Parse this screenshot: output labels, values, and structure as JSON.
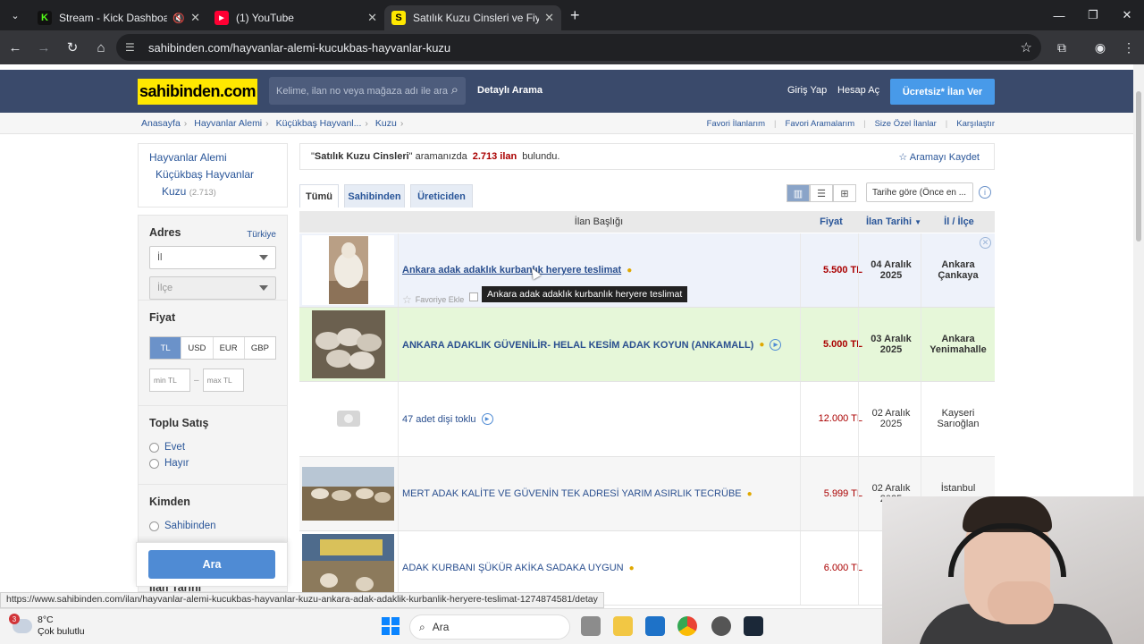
{
  "browser": {
    "tabs": [
      {
        "title": "Stream - Kick Dashboard",
        "favicon": "K",
        "color": "#53fc18",
        "active": false
      },
      {
        "title": "(1) YouTube",
        "favicon": "▶",
        "color": "#ff0033",
        "active": false
      },
      {
        "title": "Satılık Kuzu Cinsleri ve Fiyatları",
        "favicon": "S",
        "color": "#ffe800",
        "active": true
      }
    ],
    "url": "sahibinden.com/hayvanlar-alemi-kucukbas-hayvanlar-kuzu"
  },
  "header": {
    "logo": "sahibinden.com",
    "search_placeholder": "Kelime, ilan no veya mağaza adı ile ara",
    "detailed_search": "Detaylı Arama",
    "login": "Giriş Yap",
    "signup": "Hesap Aç",
    "post_ad": "Ücretsiz* İlan Ver"
  },
  "breadcrumb": [
    "Anasayfa",
    "Hayvanlar Alemi",
    "Küçükbaş Hayvanl...",
    "Kuzu"
  ],
  "toplinks": [
    "Favori İlanlarım",
    "Favori Aramalarım",
    "Size Özel İlanlar",
    "Karşılaştır"
  ],
  "sidebar": {
    "categories": {
      "l1": "Hayvanlar Alemi",
      "l2": "Küçükbaş Hayvanlar",
      "l3": "Kuzu",
      "l3_count": "(2.713)"
    },
    "adres": {
      "title": "Adres",
      "country": "Türkiye",
      "il": "İl",
      "ilce": "İlçe"
    },
    "fiyat": {
      "title": "Fiyat",
      "currencies": [
        "TL",
        "USD",
        "EUR",
        "GBP"
      ],
      "selected": "TL",
      "min_placeholder": "min TL",
      "max_placeholder": "max TL",
      "dash": "–"
    },
    "toplu": {
      "title": "Toplu Satış",
      "options": [
        "Evet",
        "Hayır"
      ]
    },
    "kimden": {
      "title": "Kimden",
      "options": [
        "Sahibinden"
      ]
    },
    "ara_button": "Ara",
    "ilan_tarihi": "İlan Tarihi"
  },
  "results": {
    "query": "Satılık Kuzu Cinsleri",
    "mid_text": "aramanızda",
    "count": "2.713 ilan",
    "suffix": "bulundu.",
    "save_search": "Aramayı Kaydet",
    "filter_tabs": [
      "Tümü",
      "Sahibinden",
      "Üreticiden"
    ],
    "sort": "Tarihe göre (Önce en ...",
    "headers": {
      "title": "İlan Başlığı",
      "price": "Fiyat",
      "date": "İlan Tarihi",
      "location": "İl / İlçe"
    },
    "favorite_label": "Favoriye Ekle",
    "listings": [
      {
        "title": "Ankara adak adaklık kurbanlık heryere teslimat",
        "price": "5.500 TL",
        "date1": "04 Aralık",
        "date2": "2025",
        "loc1": "Ankara",
        "loc2": "Çankaya",
        "bg": "#eef2fa"
      },
      {
        "title": "ANKARA ADAKLIK GÜVENİLİR- HELAL KESİM ADAK KOYUN (ANKAMALL)",
        "price": "5.000 TL",
        "date1": "03 Aralık",
        "date2": "2025",
        "loc1": "Ankara",
        "loc2": "Yenimahalle",
        "bg": "#e6f7d9"
      },
      {
        "title": "47 adet dişi toklu",
        "price": "12.000 TL",
        "date1": "02 Aralık",
        "date2": "2025",
        "loc1": "Kayseri",
        "loc2": "Sarıoğlan",
        "bg": "#ffffff"
      },
      {
        "title": "MERT ADAK KALİTE VE GÜVENİN TEK ADRESİ YARIM ASIRLIK TECRÜBE",
        "price": "5.999 TL",
        "date1": "02 Aralık",
        "date2": "2025",
        "loc1": "İstanbul",
        "loc2": "",
        "bg": "#f6f6f6"
      },
      {
        "title": "ADAK KURBANI ŞÜKÜR AKİKA SADAKA UYGUN",
        "price": "6.000 TL",
        "date1": "02",
        "date2": "",
        "loc1": "",
        "loc2": "",
        "bg": "#ffffff"
      }
    ]
  },
  "tooltip": "Ankara adak adaklık kurbanlık heryere teslimat",
  "status_url": "https://www.sahibinden.com/ilan/hayvanlar-alemi-kucukbas-hayvanlar-kuzu-ankara-adak-adaklik-kurbanlik-heryere-teslimat-1274874581/detay",
  "taskbar": {
    "temp": "8°C",
    "weather": "Çok bulutlu",
    "badge": "3",
    "search": "Ara"
  }
}
